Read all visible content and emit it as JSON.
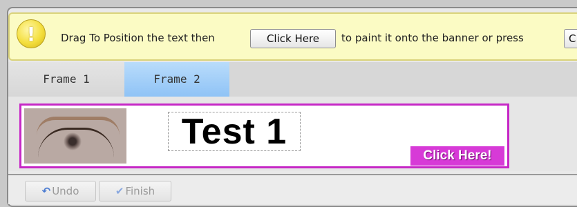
{
  "notice": {
    "icon": "warning-exclamation-icon",
    "text_before": "Drag To Position the text then",
    "button_label": "Click Here",
    "text_after": "to paint it onto the banner or press",
    "cancel_button_partial": "C"
  },
  "tabs": [
    {
      "label": "Frame 1",
      "active": false
    },
    {
      "label": "Frame 2",
      "active": true
    }
  ],
  "banner": {
    "image": "eye-photo",
    "text": "Test 1",
    "cta_label": "Click Here!",
    "border_color": "#c627c6",
    "cta_color": "#d73ad7"
  },
  "toolbar": {
    "undo_label": "Undo",
    "finish_label": "Finish",
    "undo_icon": "undo-arrow-icon",
    "finish_icon": "checkmark-icon"
  }
}
